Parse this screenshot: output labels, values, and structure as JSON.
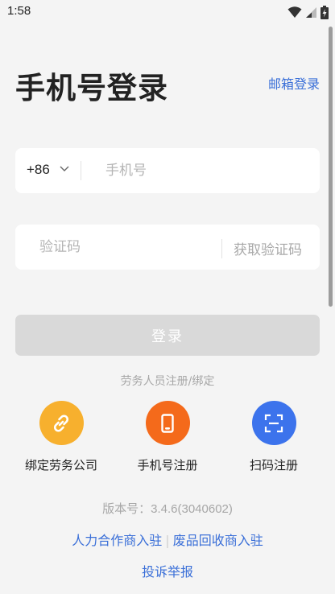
{
  "status_bar": {
    "time": "1:58"
  },
  "header": {
    "title": "手机号登录",
    "email_login": "邮箱登录"
  },
  "phone": {
    "country_code": "+86",
    "placeholder": "手机号",
    "value": ""
  },
  "code": {
    "placeholder": "验证码",
    "value": "",
    "get_code_label": "获取验证码"
  },
  "login_button": "登录",
  "register_section": {
    "label": "劳务人员注册/绑定",
    "options": [
      {
        "label": "绑定劳务公司",
        "icon": "link-icon",
        "color": "#F7B02E"
      },
      {
        "label": "手机号注册",
        "icon": "phone-icon",
        "color": "#F46A1B"
      },
      {
        "label": "扫码注册",
        "icon": "scan-icon",
        "color": "#3C73EC"
      }
    ]
  },
  "version": {
    "label": "版本号：",
    "number": "3.4.6(3040602)"
  },
  "links": {
    "partner": "人力合作商入驻",
    "recycling": "废品回收商入驻",
    "separator": "|"
  },
  "complaint": "投诉举报",
  "colors": {
    "accent": "#3A6FD8",
    "disabled_button": "#D9D9D9",
    "background": "#F4F4F4"
  }
}
